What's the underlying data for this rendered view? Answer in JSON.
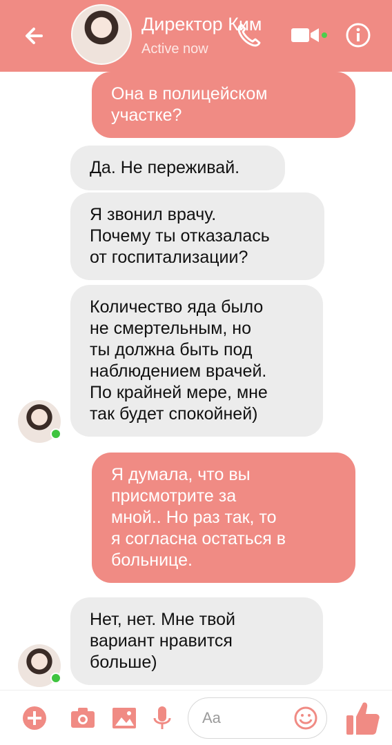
{
  "header": {
    "contact_name": "Директор Ким",
    "status": "Active now"
  },
  "messages": [
    {
      "from": "me",
      "text": "Она в полицейском\nучастке?"
    },
    {
      "from": "them",
      "text": "Да. Не переживай."
    },
    {
      "from": "them",
      "text": "Я звонил врачу.\nПочему ты отказалась\nот госпитализации?"
    },
    {
      "from": "them",
      "text": "Количество яда было\nне смертельным, но\nты должна быть под\nнаблюдением врачей.\nПо крайней мере, мне\nтак будет спокойней)"
    },
    {
      "from": "me",
      "text": "Я думала, что вы\nприсмотрите за\nмной.. Но раз так, то\nя согласна остаться в\nбольнице."
    },
    {
      "from": "them",
      "text": "Нет, нет. Мне твой\nвариант нравится\nбольше)"
    }
  ],
  "composer": {
    "placeholder": "Aa"
  },
  "colors": {
    "accent": "#f08b84",
    "incoming_bubble": "#ececec",
    "online": "#3fc43f"
  },
  "icons": [
    "back-arrow-icon",
    "phone-icon",
    "video-camera-icon",
    "info-icon",
    "plus-icon",
    "camera-icon",
    "image-icon",
    "microphone-icon",
    "emoji-icon",
    "thumbs-up-icon"
  ]
}
